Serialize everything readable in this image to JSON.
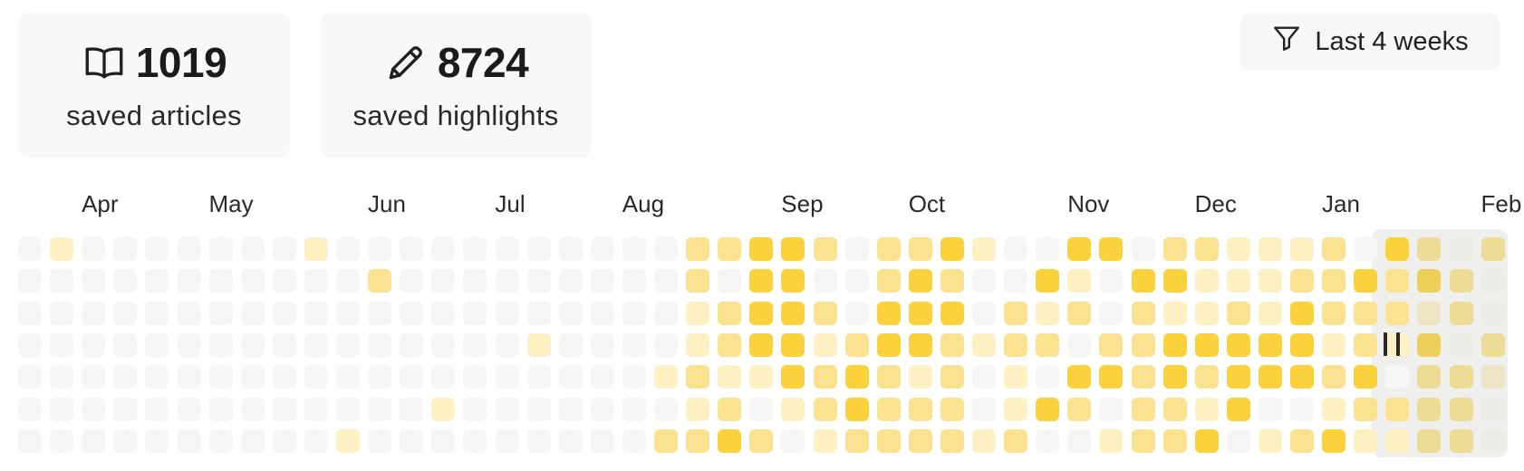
{
  "stats": {
    "articles": {
      "value": "1019",
      "label": "saved articles",
      "icon": "open-book-icon"
    },
    "highlights": {
      "value": "8724",
      "label": "saved highlights",
      "icon": "pencil-icon"
    }
  },
  "filter": {
    "label": "Last 4 weeks",
    "icon": "filter-icon"
  },
  "months": [
    "Apr",
    "May",
    "Jun",
    "Jul",
    "Aug",
    "Sep",
    "Oct",
    "Nov",
    "Dec",
    "Jan",
    "Feb"
  ],
  "month_week_index": [
    1,
    5,
    10,
    14,
    18,
    23,
    27,
    32,
    36,
    40,
    45
  ],
  "colors": {
    "levels": [
      "#f6f6f4",
      "#fdf1c4",
      "#fbe290",
      "#fbd13c",
      "#fbd030"
    ],
    "highlight_levels": [
      "#ecebe6",
      "#ede5c4",
      "#ecdc96",
      "#ecd05b",
      "#ecc942"
    ]
  },
  "heatmap": {
    "weeks": 47,
    "rows": 7,
    "current_week_start": 44,
    "activity_levels": [
      "01000000010000000000022332022310033022111203202000",
      "00000000000200000000020330023200310331112232320000",
      "00000000000000000000012332033302120211213222120222",
      "00000000000000001000012331233212202233333121302122",
      "00000000000000000000121132321201033232333230221210",
      "00000000000001000000012012322201320221300122220000",
      "00000000001000000000223201222212001223012311220000"
    ]
  }
}
